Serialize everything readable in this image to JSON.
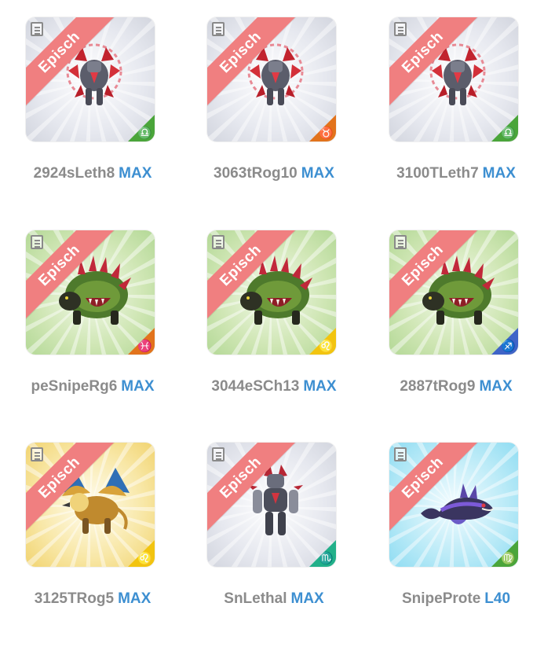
{
  "rarity_label": "Episch",
  "colors": {
    "ribbon": "#f07f80",
    "name_text": "#8b8b8b",
    "level_text": "#3d8fd1",
    "badge_green": "#4aa53a",
    "badge_orange": "#e2731c",
    "badge_yellow": "#f2c40f",
    "badge_blue": "#3f64c8",
    "badge_teal": "#22b08a"
  },
  "cards": [
    {
      "name": "2924sLeth8",
      "level": "MAX",
      "background": "gray",
      "creature": "red-armored-golem",
      "sign_icon": "libra-icon",
      "sign_glyph": "♎",
      "badge_color": "#4aa53a"
    },
    {
      "name": "3063tRog10",
      "level": "MAX",
      "background": "gray",
      "creature": "red-armored-golem",
      "sign_icon": "taurus-icon",
      "sign_glyph": "♉",
      "badge_color": "#e2731c"
    },
    {
      "name": "3100TLeth7",
      "level": "MAX",
      "background": "gray",
      "creature": "red-armored-golem",
      "sign_icon": "libra-icon",
      "sign_glyph": "♎",
      "badge_color": "#4aa53a"
    },
    {
      "name": "peSnipeRg6",
      "level": "MAX",
      "background": "green",
      "creature": "spiked-green-beast",
      "sign_icon": "pisces-icon",
      "sign_glyph": "♓",
      "badge_color": "#e2731c"
    },
    {
      "name": "3044eSCh13",
      "level": "MAX",
      "background": "green",
      "creature": "spiked-green-beast",
      "sign_icon": "leo-icon",
      "sign_glyph": "♌",
      "badge_color": "#f2c40f"
    },
    {
      "name": "2887tRog9",
      "level": "MAX",
      "background": "green",
      "creature": "spiked-green-beast",
      "sign_icon": "sagittarius-icon",
      "sign_glyph": "♐",
      "badge_color": "#3f64c8"
    },
    {
      "name": "3125TRog5",
      "level": "MAX",
      "background": "gold",
      "creature": "golden-griffin",
      "sign_icon": "leo-icon",
      "sign_glyph": "♌",
      "badge_color": "#f2c40f"
    },
    {
      "name": "SnLethal",
      "level": "MAX",
      "background": "gray",
      "creature": "dark-armored-knight",
      "sign_icon": "scorpio-icon",
      "sign_glyph": "♏",
      "badge_color": "#22b08a"
    },
    {
      "name": "SnipeProte",
      "level": "L40",
      "background": "cyan",
      "creature": "purple-sea-serpent",
      "sign_icon": "virgo-icon",
      "sign_glyph": "♍",
      "badge_color": "#4aa53a"
    }
  ]
}
